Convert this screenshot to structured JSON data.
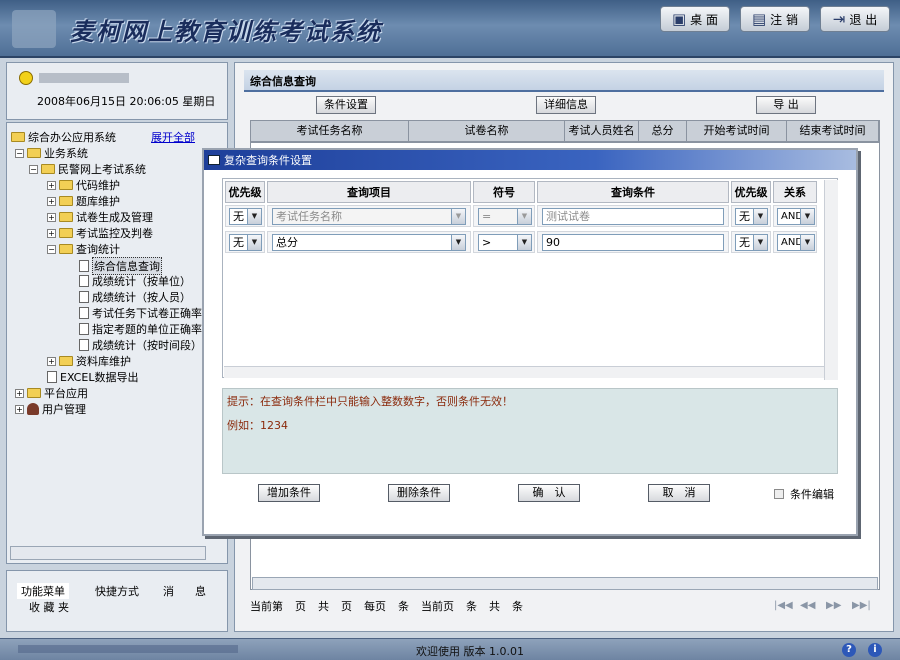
{
  "app": {
    "title": "麦柯网上教育训练考试系统"
  },
  "header_buttons": [
    {
      "label": "桌 面",
      "icon": "desktop-icon"
    },
    {
      "label": "注 销",
      "icon": "logout-books-icon"
    },
    {
      "label": "退 出",
      "icon": "exit-icon"
    }
  ],
  "user": {
    "datetime": "2008年06月15日 20:06:05 星期日"
  },
  "tree": {
    "root": "综合办公应用系统",
    "expand_all": "展开全部",
    "items": [
      "业务系统",
      "民警网上考试系统",
      "代码维护",
      "题库维护",
      "试卷生成及管理",
      "考试监控及判卷",
      "查询统计",
      "综合信息查询",
      "成绩统计（按单位）",
      "成绩统计（按人员）",
      "考试任务下试卷正确率",
      "指定考题的单位正确率",
      "成绩统计（按时间段）",
      "资料库维护",
      "EXCEL数据导出",
      "平台应用",
      "用户管理"
    ]
  },
  "left_tabs": {
    "tab1": "功能菜单",
    "tab2": "快捷方式",
    "tab3": "消",
    "tab4": "息",
    "tab5": "收 藏 夹"
  },
  "main": {
    "title": "综合信息查询",
    "btn_condition": "条件设置",
    "btn_detail": "详细信息",
    "btn_export": "导 出",
    "columns": [
      "考试任务名称",
      "试卷名称",
      "考试人员姓名",
      "总分",
      "开始考试时间",
      "结束考试时间"
    ],
    "pager": [
      "当前第",
      "页",
      "共",
      "页",
      "每页",
      "条",
      "当前页",
      "条",
      "共",
      "条"
    ]
  },
  "dialog": {
    "title": "复杂查询条件设置",
    "headers": [
      "优先级",
      "查询项目",
      "符号",
      "查询条件",
      "优先级",
      "关系"
    ],
    "rows": [
      {
        "prio1": "无",
        "item": "考试任务名称",
        "op": "=",
        "value": "测试试卷",
        "prio2": "无",
        "rel": "AND"
      },
      {
        "prio1": "无",
        "item": "总分",
        "op": ">",
        "value": "90",
        "prio2": "无",
        "rel": "AND"
      }
    ],
    "hint": "提示：在查询条件栏中只能输入整数数字，否则条件无效！",
    "example": "例如：1234",
    "btn_add": "增加条件",
    "btn_delete": "删除条件",
    "btn_ok": "确　认",
    "btn_cancel": "取　消",
    "cond_edit": "条件编辑"
  },
  "status": {
    "text": "欢迎使用 版本 1.0.01"
  }
}
